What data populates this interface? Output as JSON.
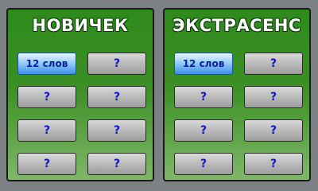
{
  "panels": [
    {
      "title": "НОВИЧЕК",
      "cells": [
        "12 слов",
        "?",
        "?",
        "?",
        "?",
        "?",
        "?",
        "?"
      ]
    },
    {
      "title": "ЭКСТРАСЕНС",
      "cells": [
        "12 слов",
        "?",
        "?",
        "?",
        "?",
        "?",
        "?",
        "?"
      ]
    }
  ],
  "colors": {
    "background": "#7e8184",
    "panel_green": "#2f8a1c",
    "cell_gray": "#bdbdbd",
    "cell_active_blue": "#3d8fe8",
    "question_mark": "#1515c8"
  }
}
